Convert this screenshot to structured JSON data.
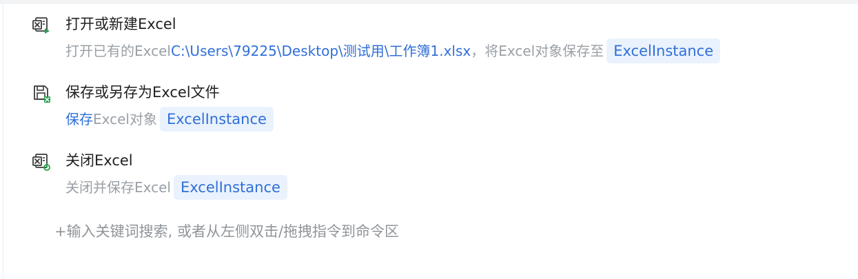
{
  "steps": [
    {
      "icon": "excel-open-icon",
      "title": "打开或新建Excel",
      "desc_prefix": "打开已有的Excel",
      "path": "C:\\Users\\79225\\Desktop\\测试用\\工作簿1.xlsx",
      "desc_middle": "，将Excel对象保存至",
      "variable": "ExcelInstance"
    },
    {
      "icon": "excel-save-icon",
      "title": "保存或另存为Excel文件",
      "action": "保存",
      "desc_suffix": "Excel对象",
      "variable": "ExcelInstance"
    },
    {
      "icon": "excel-close-icon",
      "title": "关闭Excel",
      "desc_prefix": "关闭并保存Excel",
      "variable": "ExcelInstance"
    }
  ],
  "add_hint": "+输入关键词搜索, 或者从左侧双击/拖拽指令到命令区",
  "colors": {
    "link_blue": "#2f6fd8",
    "chip_bg": "#eaf2fd",
    "muted_text": "#9aa0a6",
    "icon_green": "#22a04b",
    "icon_dark": "#3a3a3a"
  }
}
